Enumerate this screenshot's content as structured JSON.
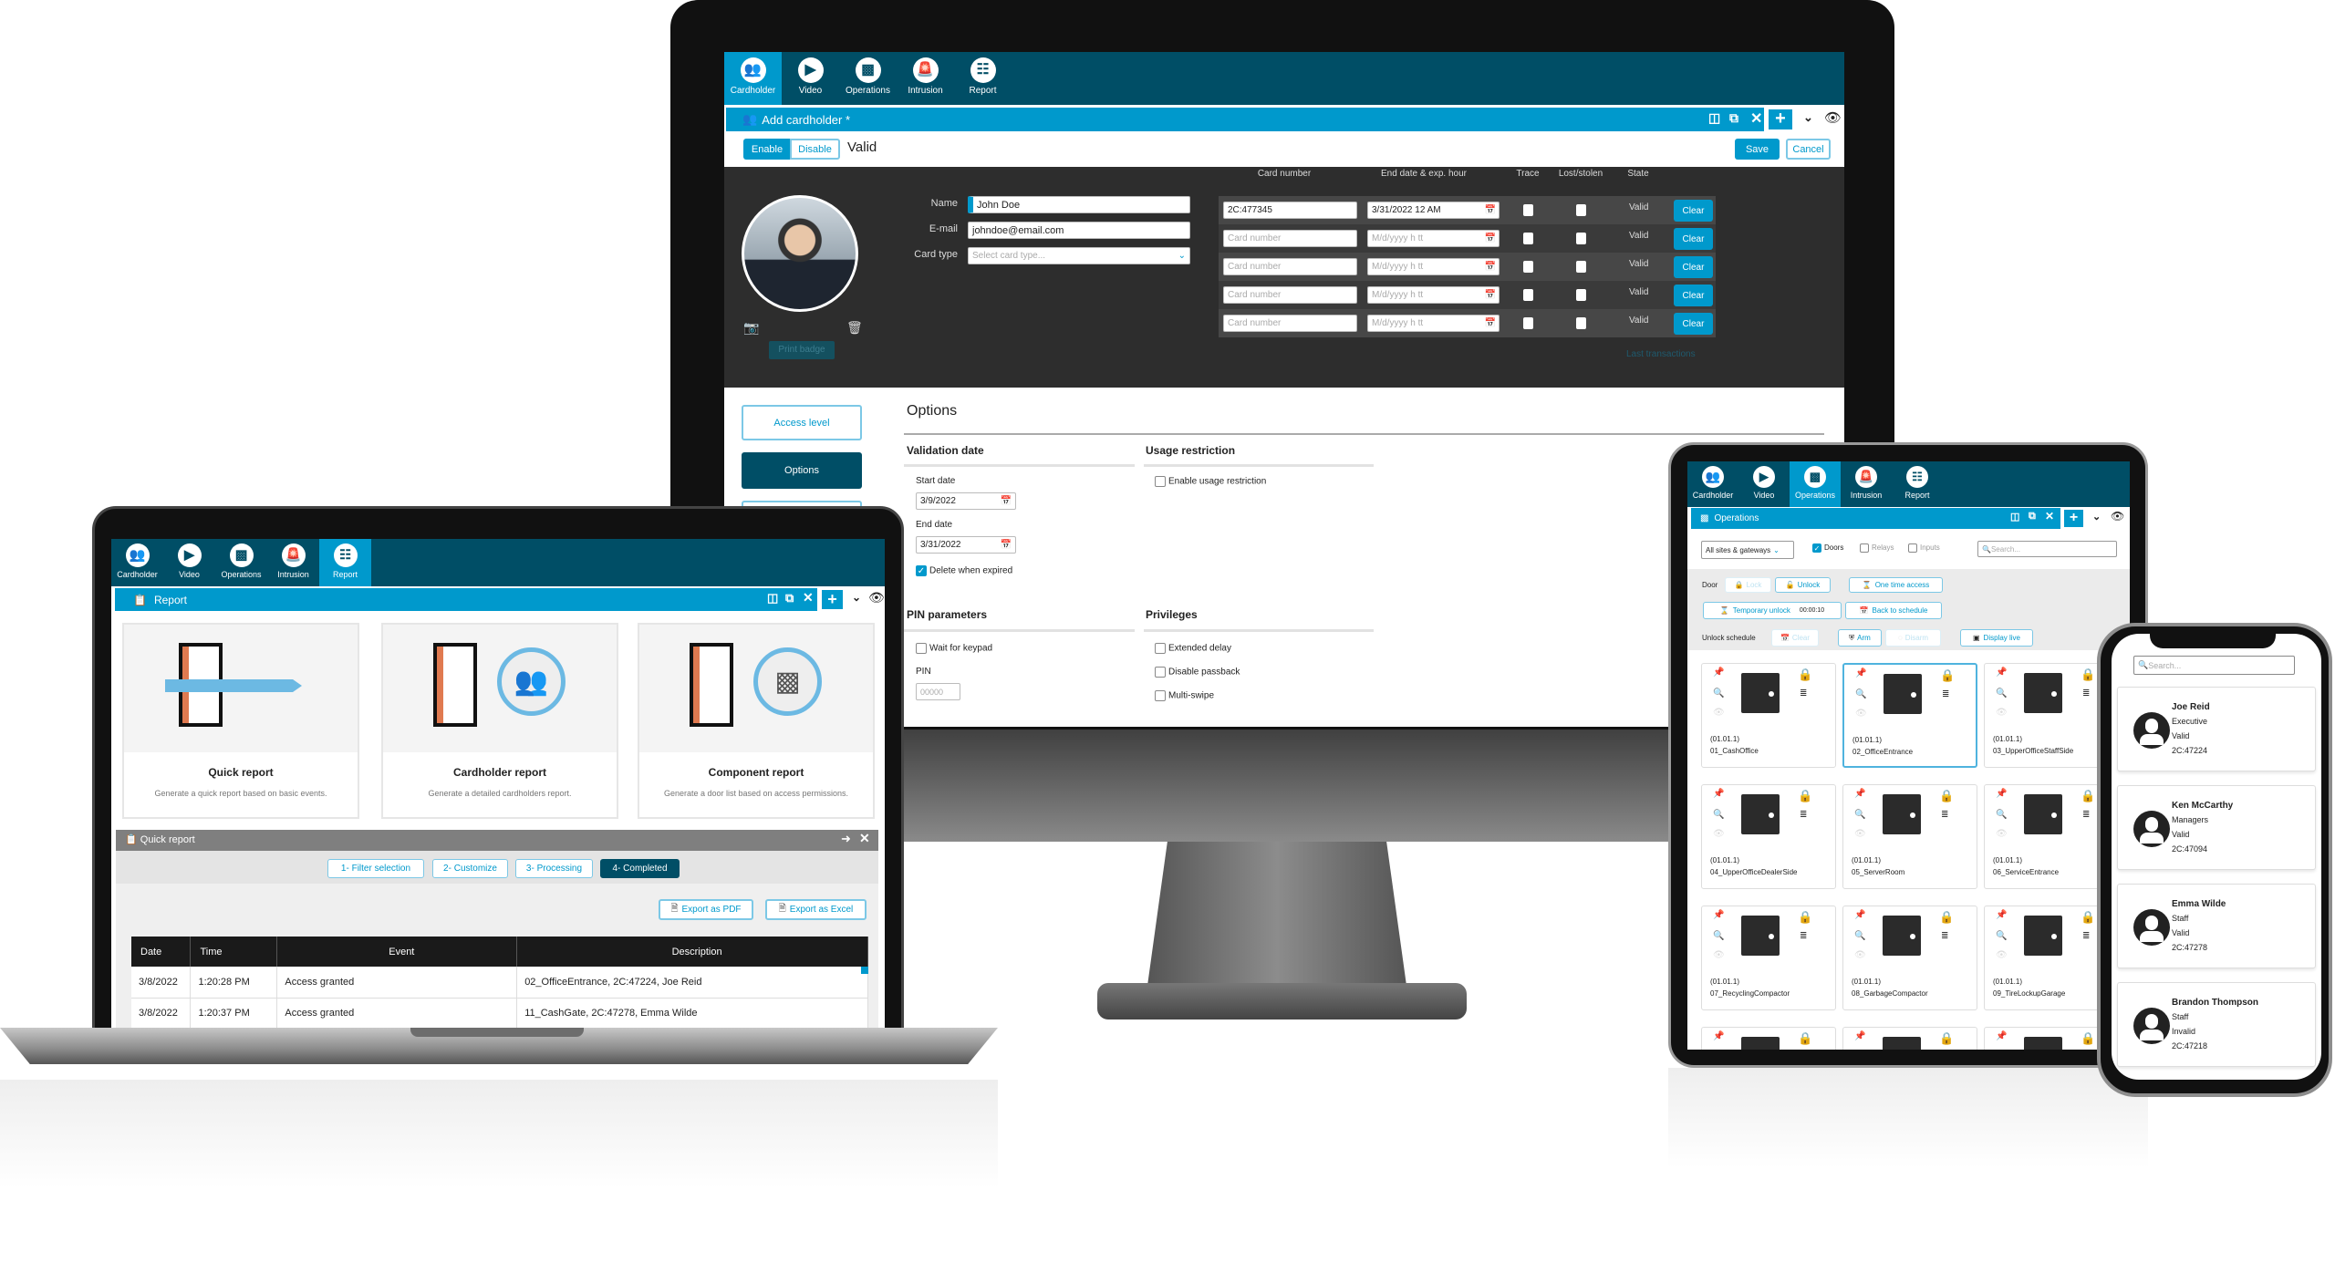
{
  "colors": {
    "nav": "#004e66",
    "accent": "#0099cc",
    "dark_panel": "#2d2d2d"
  },
  "desktop": {
    "nav_tabs": [
      {
        "label": "Cardholder",
        "icon": "users-icon",
        "active": true
      },
      {
        "label": "Video",
        "icon": "video-icon",
        "active": false
      },
      {
        "label": "Operations",
        "icon": "door-icon",
        "active": false
      },
      {
        "label": "Intrusion",
        "icon": "alarm-icon",
        "active": false
      },
      {
        "label": "Report",
        "icon": "report-icon",
        "active": false
      }
    ],
    "title": "Add cardholder *",
    "toolbar": {
      "enable": "Enable",
      "disable": "Disable",
      "status": "Valid",
      "save": "Save",
      "cancel": "Cancel"
    },
    "form": {
      "name_label": "Name",
      "name_value": "John Doe",
      "email_label": "E-mail",
      "email_value": "johndoe@email.com",
      "cardtype_label": "Card type",
      "cardtype_placeholder": "Select card type...",
      "print_badge": "Print badge"
    },
    "cards": {
      "headers": [
        "Card number",
        "End date & exp. hour",
        "Trace",
        "Lost/stolen",
        "State"
      ],
      "rows": [
        {
          "card": "2C:477345",
          "date": "3/31/2022 12 AM",
          "state": "Valid",
          "clear": "Clear"
        },
        {
          "card": "",
          "date": "",
          "state": "Valid",
          "clear": "Clear"
        },
        {
          "card": "",
          "date": "",
          "state": "Valid",
          "clear": "Clear"
        },
        {
          "card": "",
          "date": "",
          "state": "Valid",
          "clear": "Clear"
        },
        {
          "card": "",
          "date": "",
          "state": "Valid",
          "clear": "Clear"
        }
      ],
      "card_placeholder": "Card number",
      "date_placeholder": "M/d/yyyy h tt",
      "last_transactions": "Last transactions"
    },
    "sidebar": {
      "access_level": "Access level",
      "options": "Options"
    },
    "options": {
      "heading": "Options",
      "validation_date": "Validation date",
      "start_date_label": "Start date",
      "start_date": "3/9/2022",
      "end_date_label": "End date",
      "end_date": "3/31/2022",
      "delete_when_expired": "Delete when expired",
      "usage_restriction": "Usage restriction",
      "enable_usage_restriction": "Enable usage restriction",
      "pin_parameters": "PIN parameters",
      "wait_for_keypad": "Wait for keypad",
      "pin_label": "PIN",
      "pin_placeholder": "00000",
      "privileges": "Privileges",
      "extended_delay": "Extended delay",
      "disable_passback": "Disable passback",
      "multi_swipe": "Multi-swipe"
    }
  },
  "laptop": {
    "nav_tabs": [
      {
        "label": "Cardholder",
        "active": false
      },
      {
        "label": "Video",
        "active": false
      },
      {
        "label": "Operations",
        "active": false
      },
      {
        "label": "Intrusion",
        "active": false
      },
      {
        "label": "Report",
        "active": true
      }
    ],
    "title": "Report",
    "report_cards": [
      {
        "title": "Quick report",
        "desc": "Generate a quick report based on basic events."
      },
      {
        "title": "Cardholder report",
        "desc": "Generate a detailed cardholders report."
      },
      {
        "title": "Component report",
        "desc": "Generate a door list based on access permissions."
      }
    ],
    "quick_report": {
      "title": "Quick report",
      "steps": [
        "1- Filter selection",
        "2- Customize",
        "3- Processing",
        "4- Completed"
      ],
      "active_step": 4,
      "export_pdf": "Export as PDF",
      "export_excel": "Export as Excel",
      "columns": [
        "Date",
        "Time",
        "Event",
        "Description"
      ],
      "rows": [
        [
          "3/8/2022",
          "1:20:28 PM",
          "Access granted",
          "02_OfficeEntrance, 2C:47224, Joe Reid"
        ],
        [
          "3/8/2022",
          "1:20:37 PM",
          "Access granted",
          "11_CashGate, 2C:47278, Emma Wilde"
        ]
      ]
    }
  },
  "tablet": {
    "nav_tabs": [
      {
        "label": "Cardholder",
        "active": false
      },
      {
        "label": "Video",
        "active": false
      },
      {
        "label": "Operations",
        "active": true
      },
      {
        "label": "Intrusion",
        "active": false
      },
      {
        "label": "Report",
        "active": false
      }
    ],
    "title": "Operations",
    "filter": {
      "site": "All sites & gateways",
      "doors": "Doors",
      "doors_checked": true,
      "relays": "Relays",
      "relays_checked": false,
      "inputs": "Inputs",
      "inputs_checked": false,
      "search_placeholder": "Search..."
    },
    "controls": {
      "door_label": "Door",
      "lock": "Lock",
      "unlock": "Unlock",
      "one_time_access": "One time access",
      "temporary_unlock": "Temporary unlock",
      "temporary_time": "00:00:10",
      "back_to_schedule": "Back to schedule",
      "unlock_schedule_label": "Unlock schedule",
      "clear": "Clear",
      "arm": "Arm",
      "disarm": "Disarm",
      "display_live": "Display live"
    },
    "doors": [
      {
        "address": "(01.01.1)",
        "name": "01_CashOffice",
        "selected": false
      },
      {
        "address": "(01.01.1)",
        "name": "02_OfficeEntrance",
        "selected": true
      },
      {
        "address": "(01.01.1)",
        "name": "03_UpperOfficeStaffSide",
        "selected": false
      },
      {
        "address": "(01.01.1)",
        "name": "04_UpperOfficeDealerSide",
        "selected": false
      },
      {
        "address": "(01.01.1)",
        "name": "05_ServerRoom",
        "selected": false
      },
      {
        "address": "(01.01.1)",
        "name": "06_ServiceEntrance",
        "selected": false
      },
      {
        "address": "(01.01.1)",
        "name": "07_RecyclingCompactor",
        "selected": false
      },
      {
        "address": "(01.01.1)",
        "name": "08_GarbageCompactor",
        "selected": false
      },
      {
        "address": "(01.01.1)",
        "name": "09_TireLockupGarage",
        "selected": false
      },
      {
        "address": "",
        "name": "",
        "selected": false
      },
      {
        "address": "",
        "name": "",
        "selected": false
      },
      {
        "address": "",
        "name": "",
        "selected": false
      }
    ]
  },
  "phone": {
    "search_placeholder": "Search...",
    "cardholders": [
      {
        "name": "Joe Reid",
        "group": "Executive",
        "status": "Valid",
        "card": "2C:47224"
      },
      {
        "name": "Ken McCarthy",
        "group": "Managers",
        "status": "Valid",
        "card": "2C:47094"
      },
      {
        "name": "Emma Wilde",
        "group": "Staff",
        "status": "Valid",
        "card": "2C:47278"
      },
      {
        "name": "Brandon Thompson",
        "group": "Staff",
        "status": "Invalid",
        "card": "2C:47218"
      }
    ]
  }
}
